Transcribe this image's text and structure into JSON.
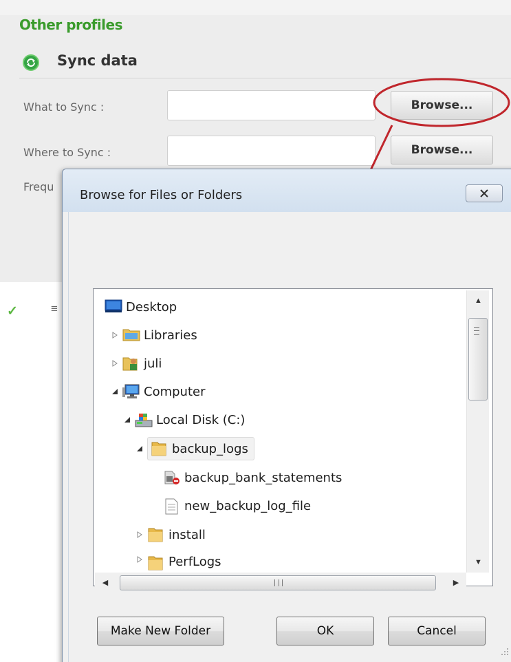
{
  "settings": {
    "section_title": "Other profiles",
    "sync_title": "Sync data",
    "what_label": "What to Sync :",
    "where_label": "Where to Sync :",
    "freq_label_fragment": "Frequ",
    "browse_label": "Browse...",
    "bottom_fragment": "≡"
  },
  "dialog": {
    "title": "Browse for Files or Folders",
    "tree": [
      {
        "label": "Desktop",
        "icon": "desktop-icon",
        "expander": "none"
      },
      {
        "label": "Libraries",
        "icon": "libraries-icon",
        "expander": "collapsed"
      },
      {
        "label": "juli",
        "icon": "user-folder-icon",
        "expander": "collapsed"
      },
      {
        "label": "Computer",
        "icon": "computer-icon",
        "expander": "expanded"
      },
      {
        "label": "Local Disk (C:)",
        "icon": "local-disk-icon",
        "expander": "expanded"
      },
      {
        "label": "backup_logs",
        "icon": "folder-icon",
        "expander": "expanded",
        "selected": true
      },
      {
        "label": "backup_bank_statements",
        "icon": "blocked-file-icon",
        "expander": "none"
      },
      {
        "label": "new_backup_log_file",
        "icon": "text-file-icon",
        "expander": "none"
      },
      {
        "label": "install",
        "icon": "folder-icon",
        "expander": "collapsed"
      },
      {
        "label": "PerfLogs",
        "icon": "folder-icon",
        "expander": "collapsed"
      }
    ],
    "buttons": {
      "new_folder": "Make New Folder",
      "ok": "OK",
      "cancel": "Cancel"
    }
  },
  "colors": {
    "section_title": "#3a9b2c",
    "callout": "#c0262c",
    "selection": "#f2f2f2"
  }
}
